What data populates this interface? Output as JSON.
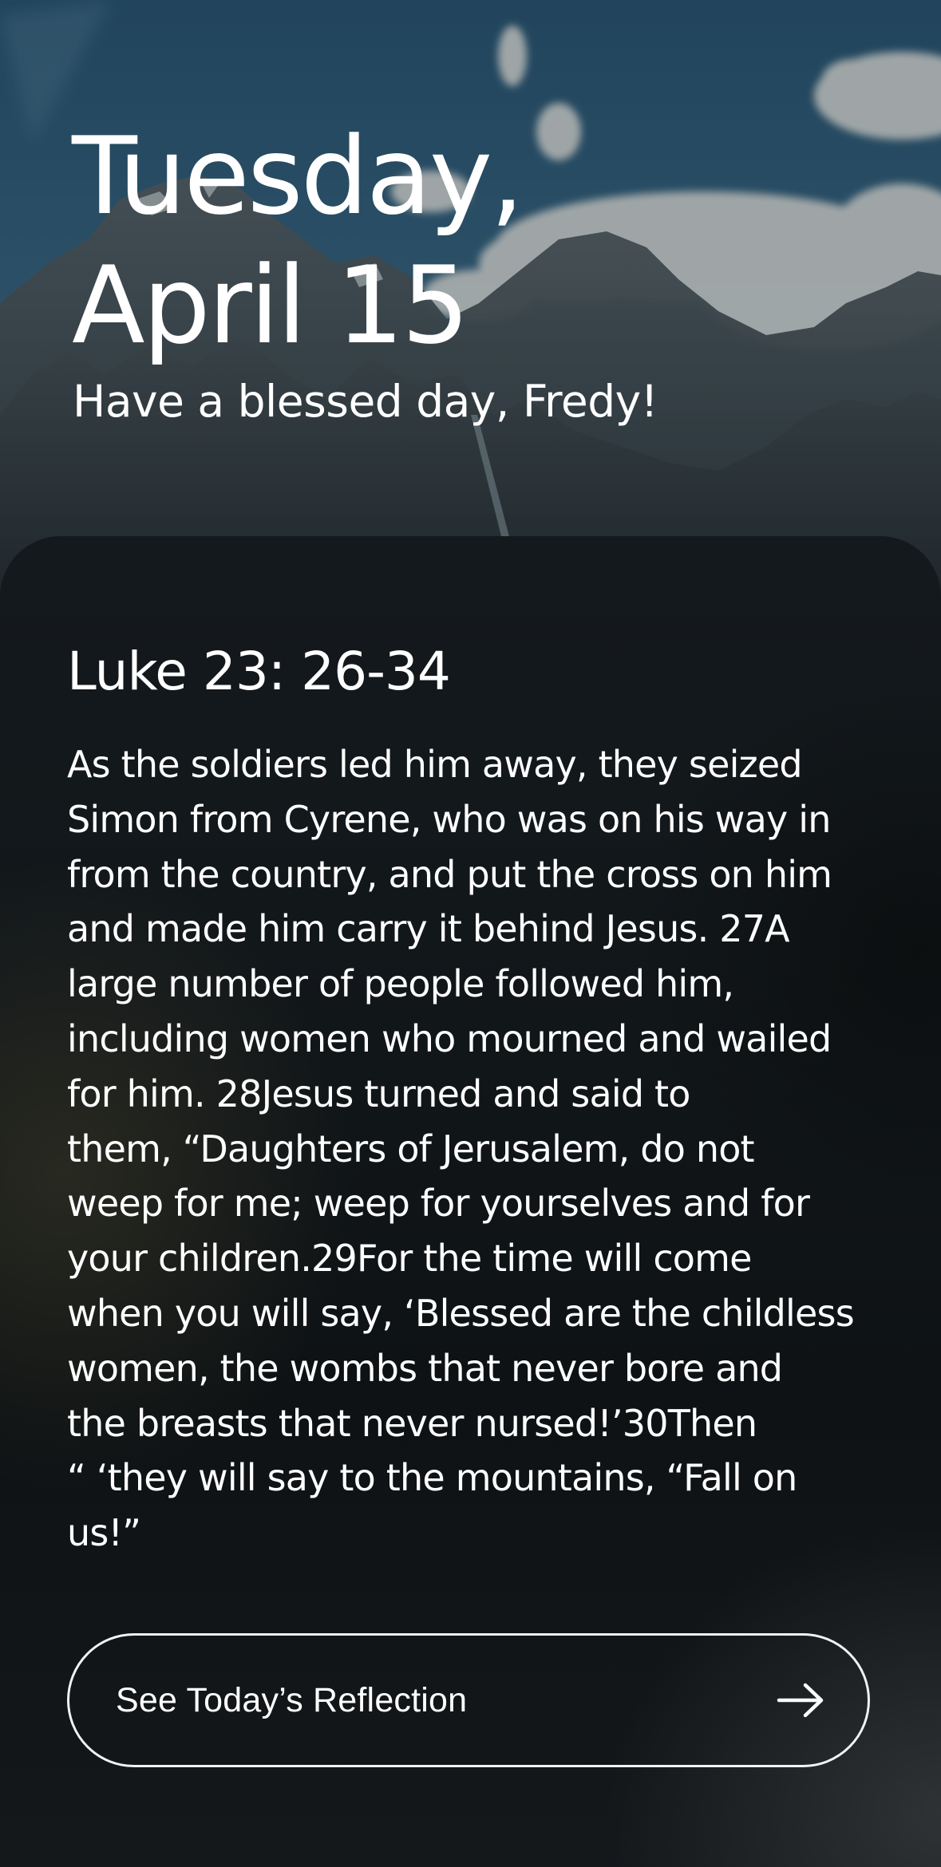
{
  "header": {
    "weekday": "Tuesday,",
    "date": "April 15",
    "greeting": "Have a blessed day, Fredy!"
  },
  "background": {
    "image": "mountain-landscape",
    "sky_color": "#2e5a77",
    "cloud_color": "#e6e7e5",
    "mountain_color": "#3a4147"
  },
  "verse": {
    "reference": "Luke 23: 26-34",
    "lines": [
      "As the soldiers led him away, they seized",
      "Simon from Cyrene, who was on his way in",
      "from the country, and put the cross on him",
      "and made him carry it behind Jesus. 27A",
      "large number of people followed him,",
      "including women who mourned and wailed",
      "for him. 28Jesus turned and said to",
      "them, “Daughters of Jerusalem, do not",
      "weep for me; weep for yourselves and for",
      "your children.29For the time will come",
      "when you will say, ‘Blessed are the childless",
      "women, the wombs that never bore and",
      "the breasts that never nursed!’30Then",
      "“ ‘they will say to the mountains, “Fall on",
      "us!”"
    ]
  },
  "actions": {
    "reflection_label": "See Today’s Reflection",
    "reflection_icon": "arrow-right-icon"
  }
}
